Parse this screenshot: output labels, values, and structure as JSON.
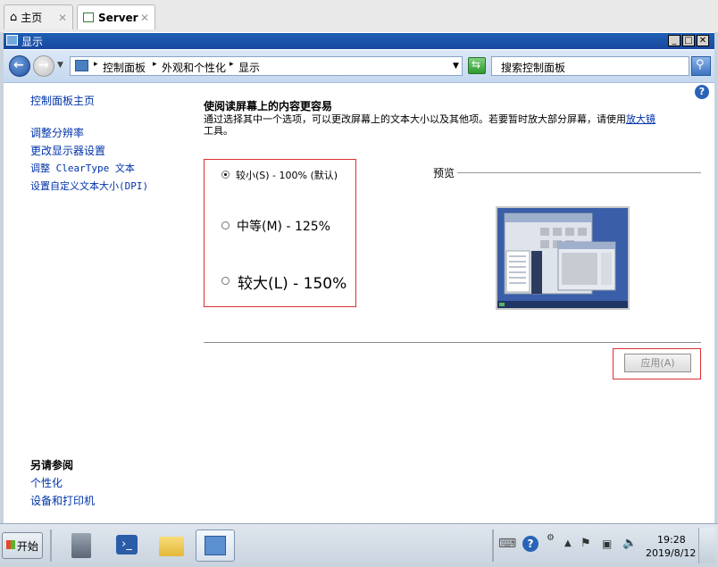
{
  "tabs": [
    {
      "label": "主页"
    },
    {
      "label": "Server"
    }
  ],
  "window": {
    "title": "显示"
  },
  "breadcrumb": {
    "items": [
      "控制面板",
      "外观和个性化",
      "显示"
    ]
  },
  "search": {
    "placeholder": "搜索控制面板"
  },
  "leftnav": {
    "home": "控制面板主页",
    "links": [
      "调整分辨率",
      "更改显示器设置",
      "调整 ClearType 文本",
      "设置自定义文本大小(DPI)"
    ]
  },
  "seealso": {
    "heading": "另请参阅",
    "links": [
      "个性化",
      "设备和打印机"
    ]
  },
  "main": {
    "heading": "使阅读屏幕上的内容更容易",
    "desc_line1": "通过选择其中一个选项，可以更改屏幕上的文本大小以及其他项。若要暂时放大部分屏幕，请使用",
    "desc_link": "放大镜",
    "desc_line2": "工具。",
    "preview_label": "预览",
    "options": [
      {
        "label": "较小(S) - 100% (默认)",
        "selected": true
      },
      {
        "label": "中等(M) - 125%",
        "selected": false
      },
      {
        "label": "较大(L) - 150%",
        "selected": false
      }
    ],
    "apply_label": "应用(A)"
  },
  "taskbar": {
    "start_label": "开始",
    "time": "19:28",
    "date": "2019/8/12"
  },
  "colors": {
    "link": "#0033aa",
    "highlight_box": "#e03030",
    "titlebar": "#1848a0"
  }
}
